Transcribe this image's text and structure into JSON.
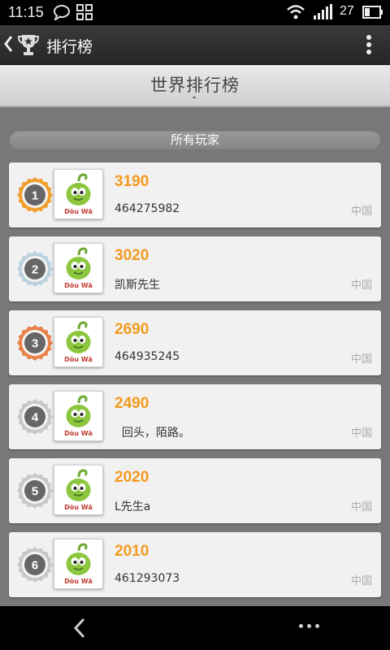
{
  "status_bar": {
    "time": "11:15",
    "battery_level": "27",
    "icons": [
      "chat-icon",
      "grid-icon",
      "wifi-icon",
      "signal-icon",
      "battery-icon"
    ]
  },
  "action_bar": {
    "title": "排行榜",
    "icons": [
      "back-chevron-icon",
      "trophy-icon",
      "overflow-menu-icon"
    ]
  },
  "header": {
    "title": "世界排行榜"
  },
  "section": {
    "label": "所有玩家"
  },
  "avatar_label": "Dòu Wā",
  "ranks": [
    {
      "rank": "1",
      "score": "3190",
      "name": "464275982",
      "country": "中国",
      "medal_color": "#f0a030"
    },
    {
      "rank": "2",
      "score": "3020",
      "name": "凯斯先生",
      "country": "中国",
      "medal_color": "#b9d2dd"
    },
    {
      "rank": "3",
      "score": "2690",
      "name": "464935245",
      "country": "中国",
      "medal_color": "#e8814a"
    },
    {
      "rank": "4",
      "score": "2490",
      "name": "  回头，陌路。",
      "country": "中国",
      "medal_color": "#c8c8c8"
    },
    {
      "rank": "5",
      "score": "2020",
      "name": "L先生a",
      "country": "中国",
      "medal_color": "#c8c8c8"
    },
    {
      "rank": "6",
      "score": "2010",
      "name": "461293073",
      "country": "中国",
      "medal_color": "#c8c8c8"
    }
  ],
  "colors": {
    "score": "#f39a1e",
    "background": "#787878",
    "card": "#f1f1f1"
  },
  "nav_bar": {
    "icons": [
      "nav-back-icon",
      "nav-more-icon"
    ]
  }
}
